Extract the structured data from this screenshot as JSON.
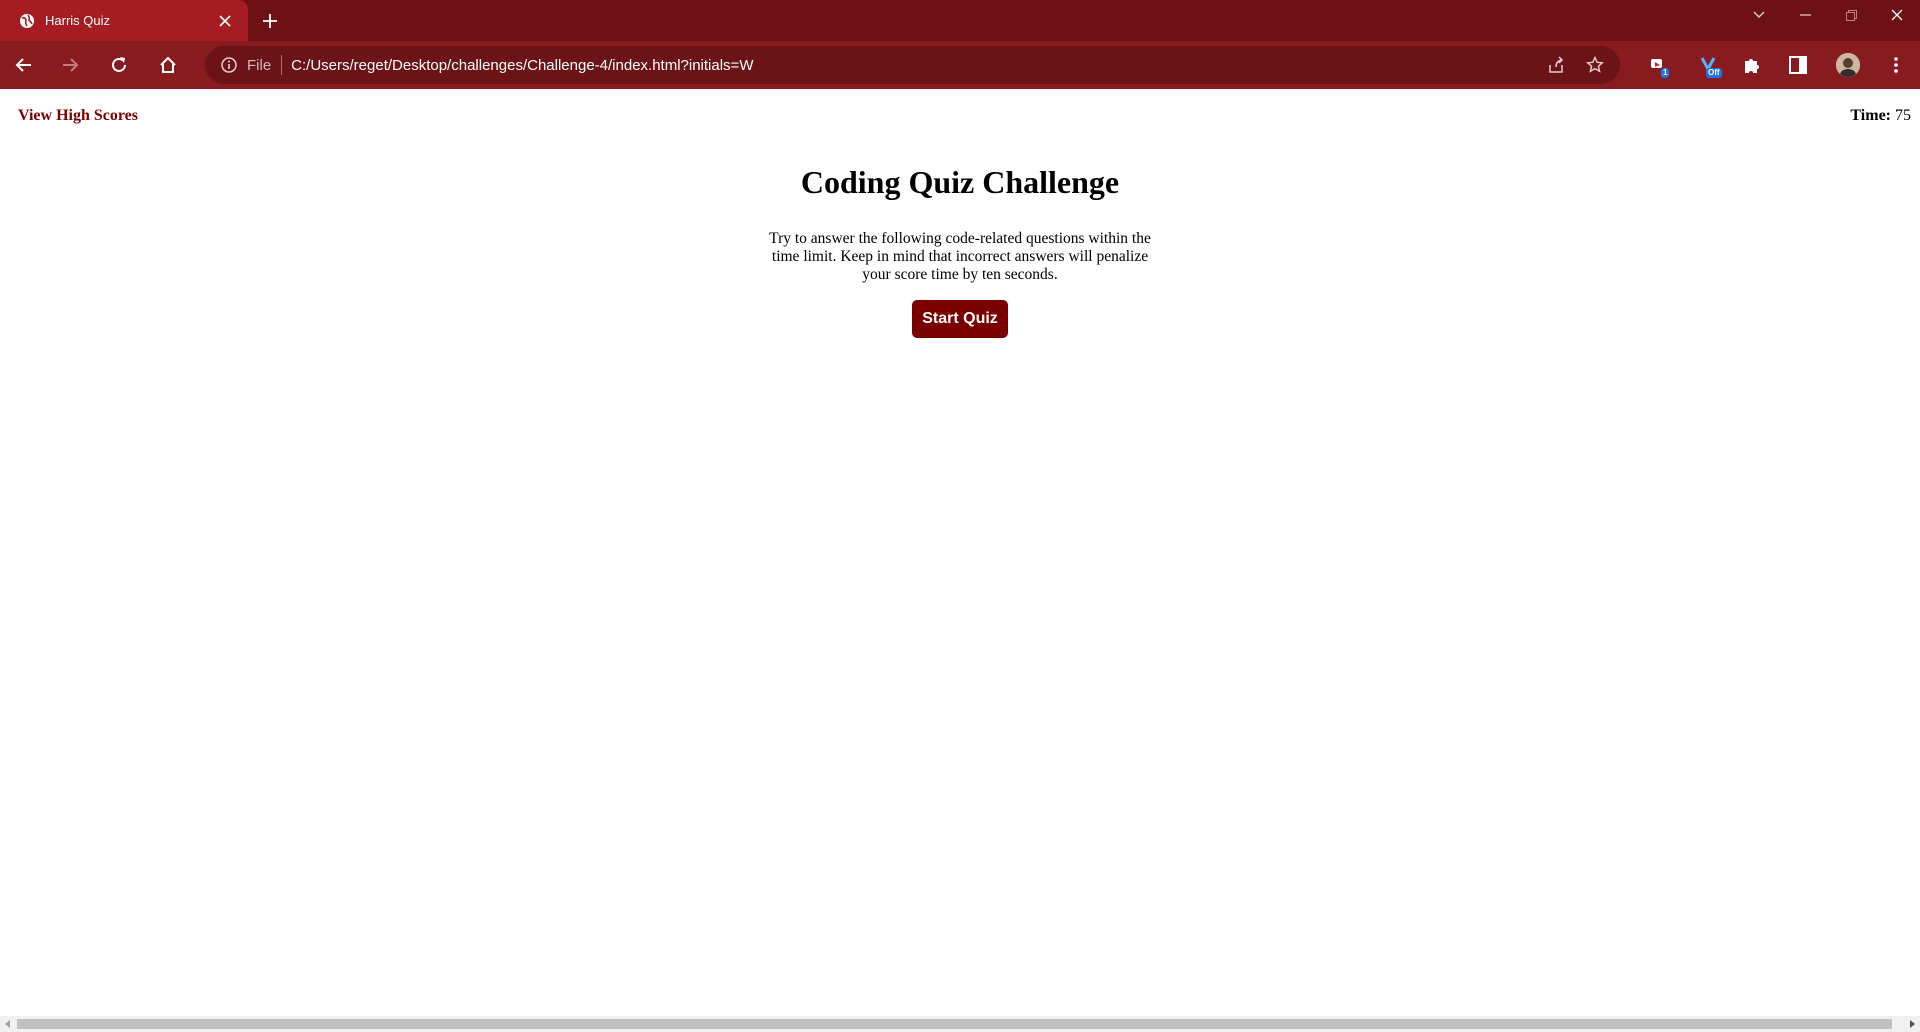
{
  "browser": {
    "tab": {
      "title": "Harris Quiz",
      "favicon": "globe-icon"
    },
    "address_bar": {
      "scheme_label": "File",
      "url": "C:/Users/reget/Desktop/challenges/Challenge-4/index.html?initials=W"
    },
    "extensions": [
      {
        "name": "extension-icon-1",
        "badge": "1"
      },
      {
        "name": "extension-icon-2",
        "badge": "Off"
      }
    ],
    "colors": {
      "tabstrip": "#6e1114",
      "active_tab": "#a51c22",
      "toolbar": "#881b1f",
      "omnibox": "#6b1316"
    }
  },
  "page": {
    "high_scores_link": "View High Scores",
    "timer": {
      "label": "Time:",
      "value": "75"
    },
    "title": "Coding Quiz Challenge",
    "description": "Try to answer the following code-related questions within the time limit. Keep in mind that incorrect answers will penalize your score time by ten seconds.",
    "start_button": "Start Quiz",
    "colors": {
      "accent": "#7a0000",
      "background": "#ffffff"
    }
  }
}
